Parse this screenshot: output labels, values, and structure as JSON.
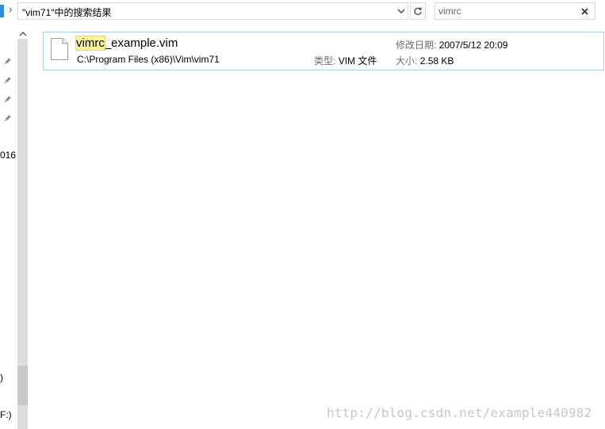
{
  "address_bar": {
    "separator": "›",
    "location_text": "\"vim71\"中的搜索结果"
  },
  "search": {
    "value": "vimrc"
  },
  "nav_pane": {
    "partial_labels": [
      "016",
      ")",
      "F:)"
    ]
  },
  "results": [
    {
      "name_highlight": "vimrc",
      "name_rest": "_example.vim",
      "path": "C:\\Program Files (x86)\\Vim\\vim71",
      "type_label": "类型:",
      "type_value": "VIM 文件",
      "modified_label": "修改日期:",
      "modified_value": "2007/5/12 20:09",
      "size_label": "大小:",
      "size_value": "2.58 KB"
    }
  ],
  "watermark": "http://blog.csdn.net/example440982",
  "colors": {
    "selection_border": "#9fd3ef",
    "highlight": "#fff59d",
    "nav_accent": "#2c8fde"
  },
  "icons": [
    "chevron-right-icon",
    "chevron-down-icon",
    "refresh-icon",
    "close-icon",
    "pin-icon",
    "file-icon",
    "chevron-up-icon"
  ]
}
